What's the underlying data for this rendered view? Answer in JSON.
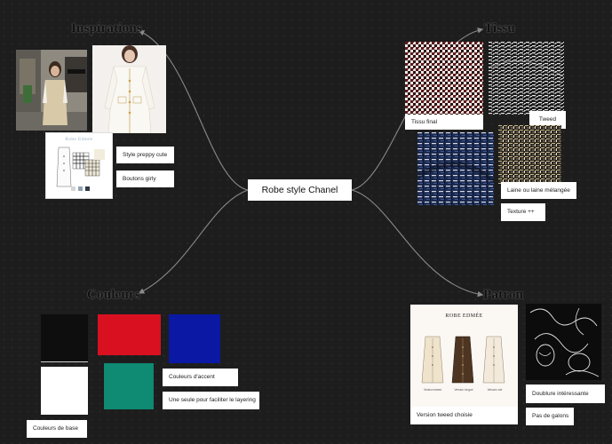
{
  "center": {
    "label": "Robe style Chanel"
  },
  "branches": {
    "inspirations": {
      "title": "Inspirations",
      "notes": [
        "Style preppy cute",
        "Boutons girly"
      ],
      "pattern_card": {
        "brand": "Robe Edmée"
      }
    },
    "tissu": {
      "title": "Tissu",
      "notes": [
        "Tissu final",
        "Tweed",
        "Laine ou laine mélangée",
        "Texture ++"
      ]
    },
    "couleurs": {
      "title": "Couleurs",
      "notes": [
        "Couleurs de base",
        "Couleurs d'accent",
        "Une seule pour faciliter le layering"
      ],
      "swatches": {
        "black": "#0e0e0e",
        "white": "#ffffff",
        "red": "#d9101f",
        "blue": "#0a18a3",
        "teal": "#0f8a73"
      }
    },
    "patron": {
      "title": "Patron",
      "notes": [
        "Version tweed choisie",
        "Doublure intéressante",
        "Pas de galons"
      ],
      "pattern_card": {
        "brand": "ROBE EDMÉE",
        "variants": [
          "Version tweed",
          "Version longue",
          "Velours noir"
        ]
      }
    }
  },
  "colors": {
    "background": "#1d1d1d",
    "connector": "#8a8a8a",
    "note_bg": "#ffffff"
  }
}
